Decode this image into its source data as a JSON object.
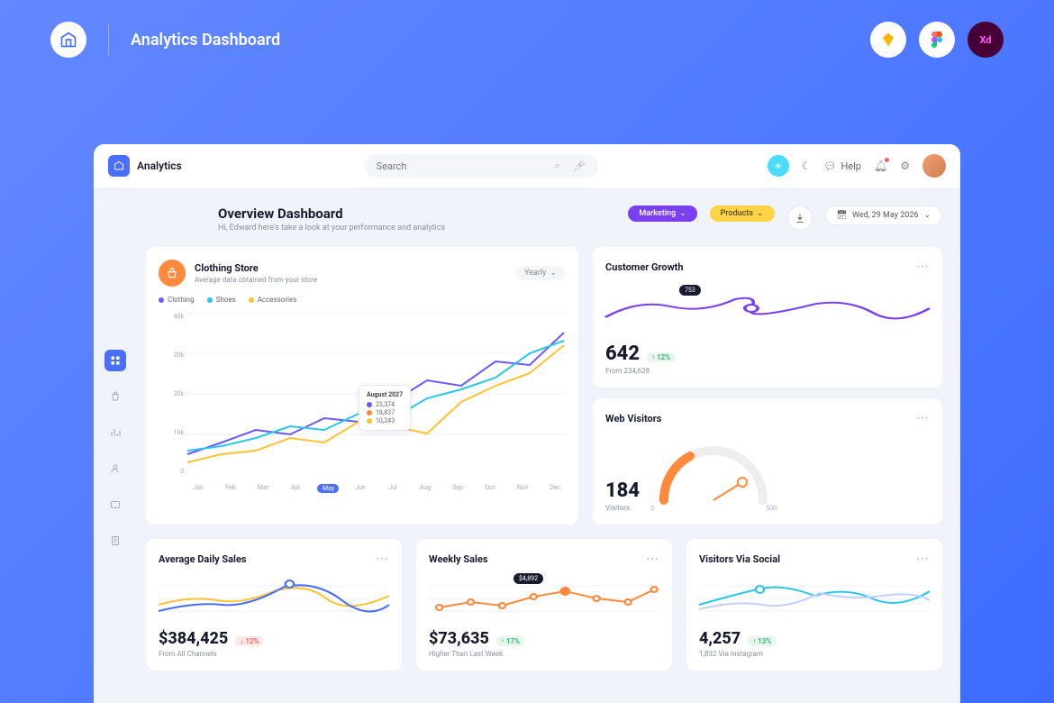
{
  "outer": {
    "title": "Analytics Dashboard"
  },
  "brand": "Analytics",
  "search": {
    "placeholder": "Search"
  },
  "help": "Help",
  "page": {
    "title": "Overview Dashboard",
    "subtitle": "Hi, Edward here's take a look at your performance and analytics",
    "marketing": "Marketing",
    "products": "Products",
    "date": "Wed, 29 May 2026"
  },
  "store": {
    "title": "Clothing Store",
    "subtitle": "Average data obtained from your store",
    "period": "Yearly",
    "legend": {
      "clothing": "Clothing",
      "shoes": "Shoes",
      "accessories": "Accessories"
    },
    "tooltip": {
      "month": "August 2027",
      "clothing": "23,374",
      "shoes": "18,837",
      "accessories": "10,243"
    }
  },
  "growth": {
    "title": "Customer Growth",
    "value": "642",
    "pct": "12%",
    "from": "From 234,628",
    "badge": "753"
  },
  "visitors": {
    "title": "Web Visitors",
    "value": "184",
    "label": "Visitors",
    "min": "0",
    "max": "500"
  },
  "daily": {
    "title": "Average Daily Sales",
    "value": "$384,425",
    "pct": "12%",
    "from": "From All Channels"
  },
  "weekly": {
    "title": "Weekly Sales",
    "value": "$73,635",
    "pct": "17%",
    "from": "Higher Than Last Week",
    "badge": "$4,892"
  },
  "social": {
    "title": "Visitors Via Social",
    "value": "4,257",
    "pct": "13%",
    "from": "1,832 Via Instagram"
  },
  "chart_data": {
    "main": {
      "type": "line",
      "categories": [
        "Jan",
        "Feb",
        "Mar",
        "Apr",
        "May",
        "Jun",
        "Jul",
        "Aug",
        "Sep",
        "Oct",
        "Nov",
        "Dec"
      ],
      "ylim": [
        0,
        40000
      ],
      "yticks": [
        "40k",
        "30k",
        "20k",
        "10k",
        "0"
      ],
      "series": [
        {
          "name": "Clothing",
          "color": "#6b59ff",
          "values": [
            5000,
            8000,
            11000,
            10000,
            14000,
            13000,
            18000,
            23374,
            22000,
            28000,
            27000,
            35000
          ]
        },
        {
          "name": "Shoes",
          "color": "#2bc6e8",
          "values": [
            6000,
            7000,
            9000,
            12000,
            11000,
            15000,
            14000,
            18837,
            21000,
            24000,
            30000,
            33000
          ]
        },
        {
          "name": "Accessories",
          "color": "#ffc234",
          "values": [
            3000,
            5000,
            6000,
            9000,
            8000,
            13000,
            12000,
            10243,
            18000,
            22000,
            25000,
            32000
          ]
        }
      ]
    },
    "growth": {
      "type": "line",
      "values": [
        620,
        680,
        700,
        753,
        690,
        710,
        660,
        720,
        700,
        680
      ]
    },
    "daily": {
      "type": "line",
      "series": [
        {
          "color": "#ffc234",
          "values": [
            300,
            320,
            310,
            340,
            330,
            350,
            320,
            360
          ]
        },
        {
          "color": "#4a6fff",
          "values": [
            280,
            300,
            330,
            320,
            370,
            340,
            350,
            310
          ]
        }
      ]
    },
    "weekly": {
      "type": "line",
      "color": "#ff8a3d",
      "values": [
        3000,
        3500,
        3200,
        4100,
        4892,
        4200,
        3900,
        5100
      ]
    },
    "social": {
      "type": "line",
      "series": [
        {
          "color": "#2bc6e8",
          "values": [
            3800,
            4000,
            4300,
            4100,
            4400,
            4200,
            4500,
            4300
          ]
        },
        {
          "color": "#8aa0ff",
          "values": [
            3600,
            3900,
            3800,
            4200,
            4000,
            4300,
            4100,
            4400
          ]
        }
      ]
    }
  }
}
